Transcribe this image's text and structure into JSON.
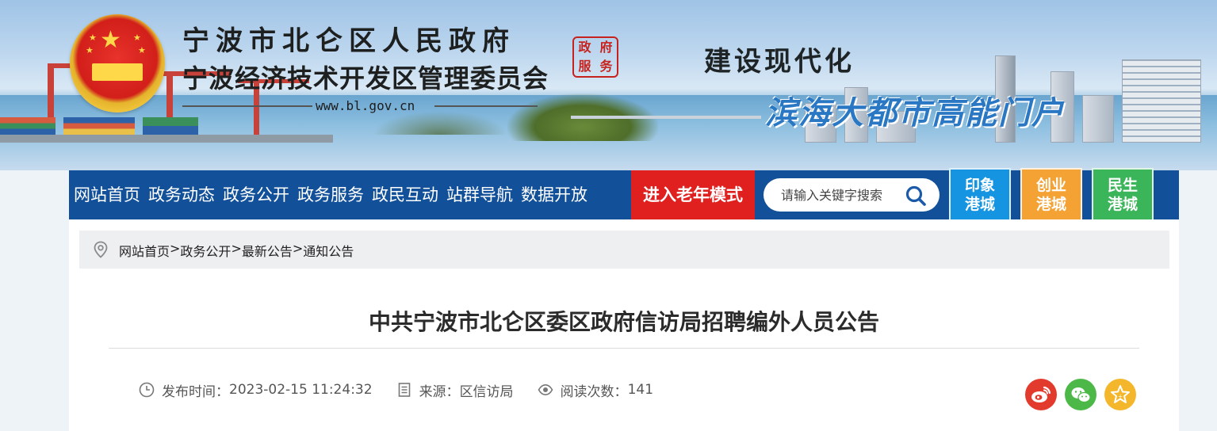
{
  "banner": {
    "title_line1": "宁波市北仑区人民政府",
    "title_line2": "宁波经济技术开发区管理委员会",
    "url": "www.bl.gov.cn",
    "seal_chars": [
      "政",
      "府",
      "服",
      "务"
    ],
    "slogan_line1": "建设现代化",
    "slogan_line2": "滨海大都市高能门户"
  },
  "nav": {
    "items": [
      "网站首页",
      "政务动态",
      "政务公开",
      "政务服务",
      "政民互动",
      "站群导航",
      "数据开放"
    ],
    "elder_mode": "进入老年模式",
    "search_placeholder": "请输入关键字搜索",
    "tiles": [
      {
        "line1": "印象",
        "line2": "港城",
        "color": "#1594e2"
      },
      {
        "line1": "创业",
        "line2": "港城",
        "color": "#f3a233"
      },
      {
        "line1": "民生",
        "line2": "港城",
        "color": "#3bb55a"
      }
    ]
  },
  "breadcrumb": [
    "网站首页",
    ">",
    "政务公开",
    ">",
    "最新公告",
    ">",
    "通知公告"
  ],
  "article": {
    "title": "中共宁波市北仑区委区政府信访局招聘编外人员公告",
    "publish_label": "发布时间：",
    "publish_time": "2023-02-15 11:24:32",
    "source_label": "来源：",
    "source": "区信访局",
    "views_label": "阅读次数：",
    "views": "141"
  },
  "share": {
    "weibo_color": "#e33a2e",
    "wechat_color": "#4cb848",
    "favorite_color": "#f4b62b"
  }
}
